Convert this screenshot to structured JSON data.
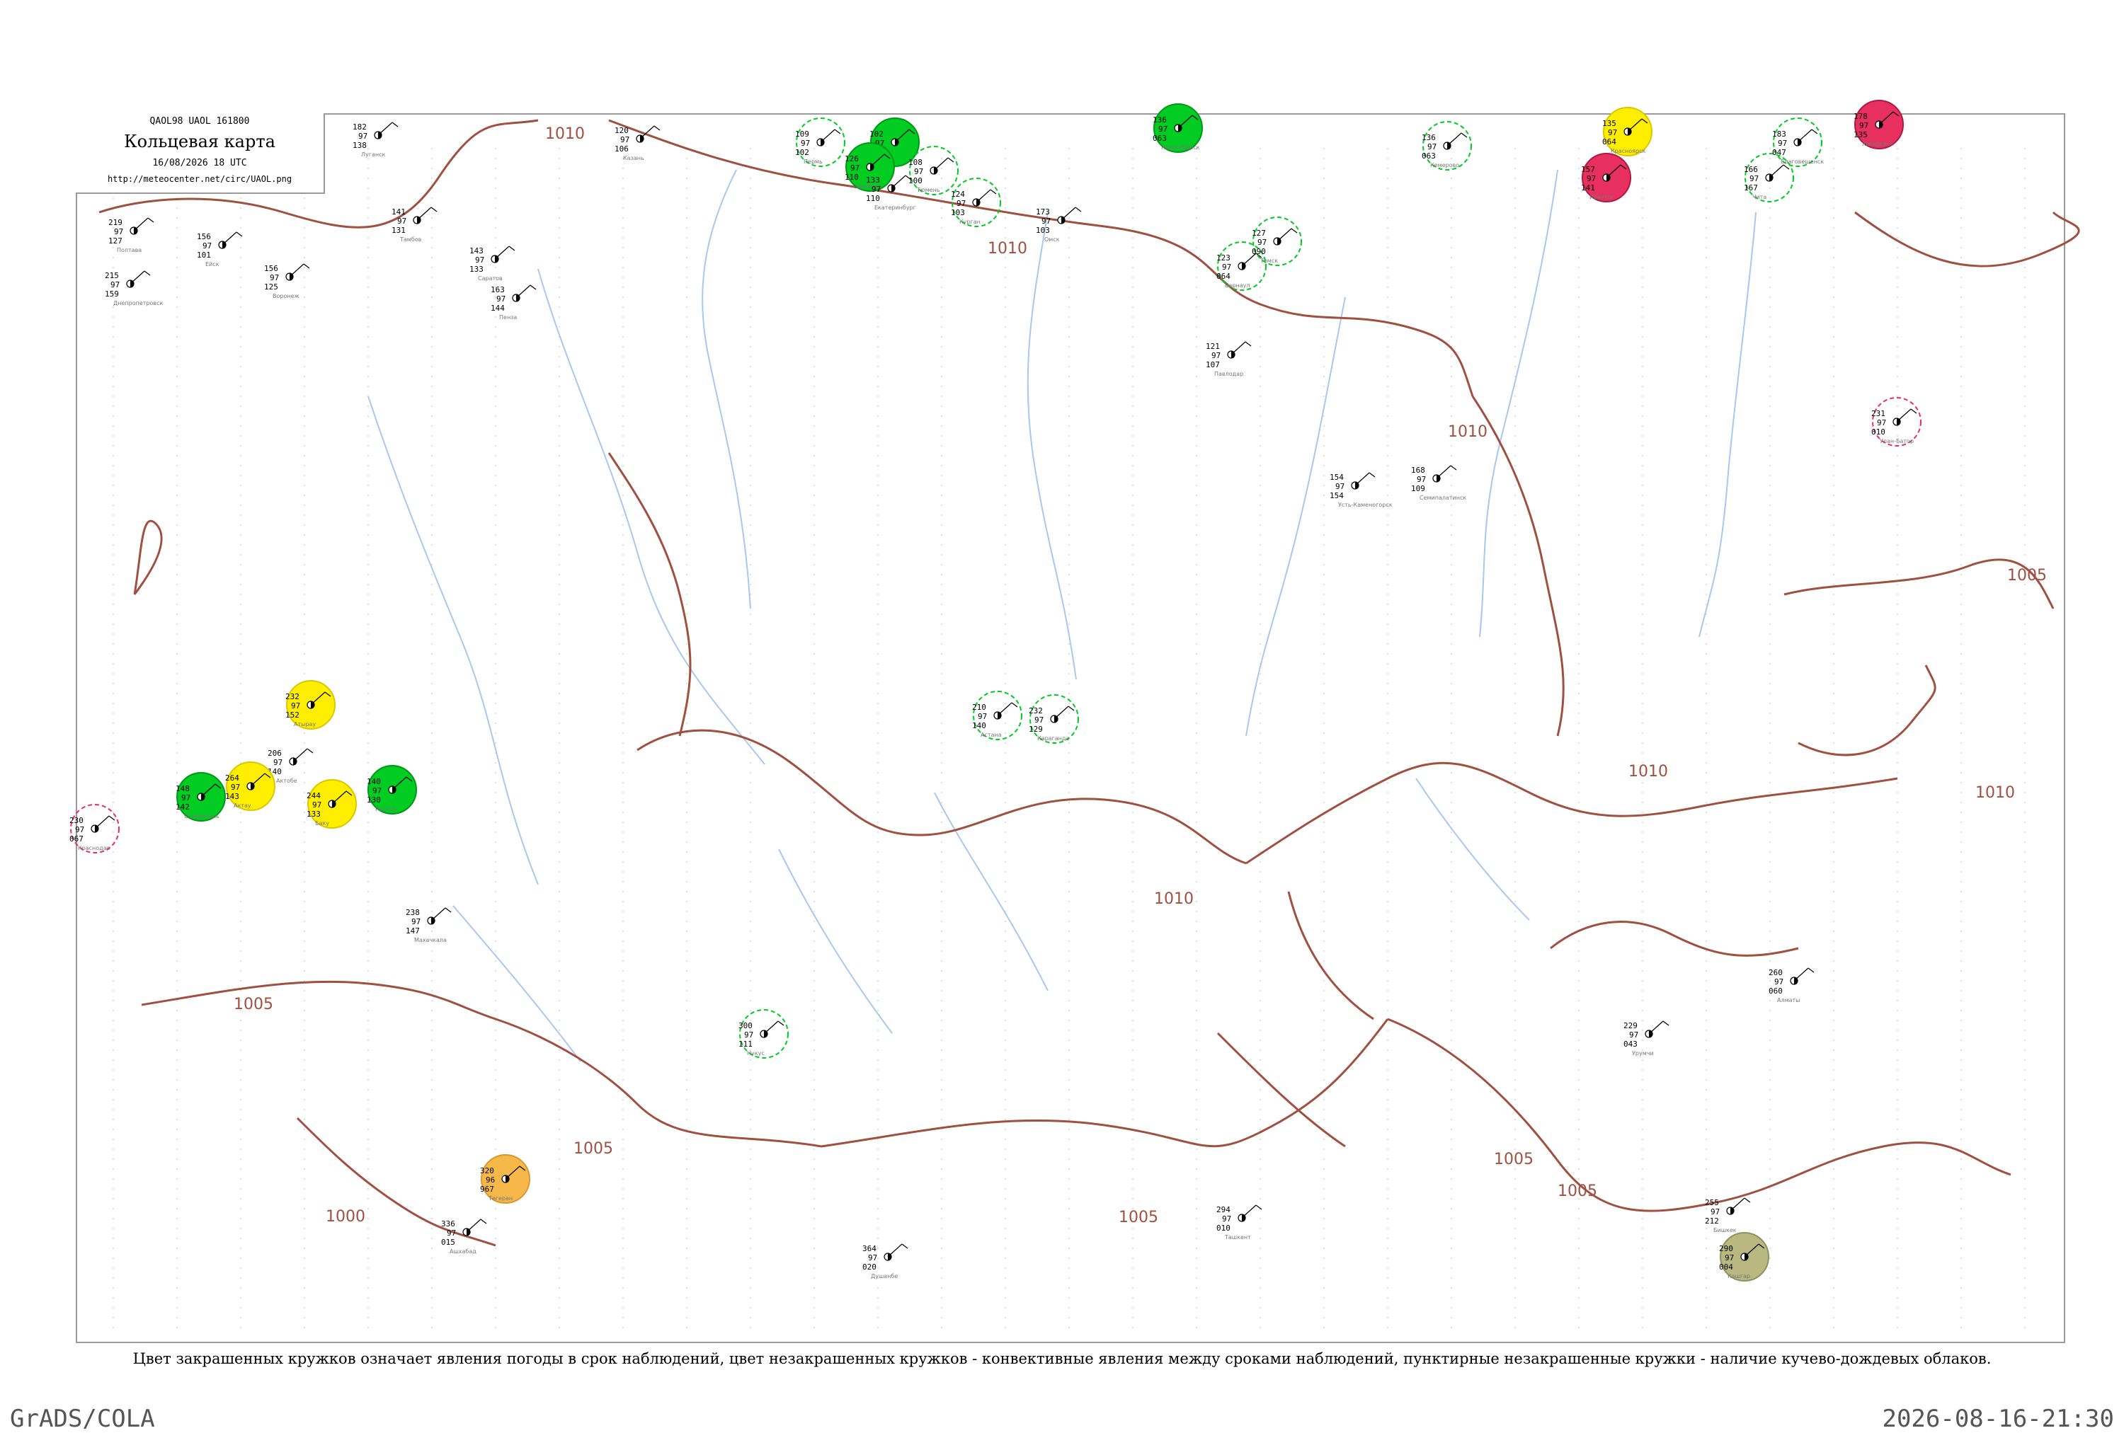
{
  "header": {
    "codes": "QAOL98  UAOL  161800",
    "title": "Кольцевая карта",
    "time": "16/08/2026 18 UTC",
    "url": "http://meteocenter.net/circ/UAOL.png"
  },
  "caption": "Цвет закрашенных кружков означает явления погоды в срок наблюдений, цвет незакрашенных кружков - конвективные явления между сроками наблюдений, пунктирные незакрашенные кружки - наличие кучево-дождевых облаков.",
  "footer": {
    "left": "GrADS/COLA",
    "right": "2026-08-16-21:30"
  },
  "colors": {
    "isobar": "#a05040",
    "river": "#a8c8f0",
    "thunderstorm": "#00cc22",
    "hail_or_heavy": "#e83060",
    "rain": "#ffee00",
    "dust": "#f7b84a",
    "fog": "#b8b880"
  },
  "map": {
    "isobar_labels": [
      "1010",
      "1010",
      "1010",
      "1010",
      "1010",
      "1010",
      "1005",
      "1005",
      "1005",
      "1005",
      "1005",
      "1005",
      "1000"
    ],
    "stations": [
      {
        "name": "Луганск",
        "pressure": "182",
        "temp": "97",
        "dew": "138",
        "marker": "none"
      },
      {
        "name": "Полтава",
        "pressure": "219",
        "temp": "97",
        "dew": "127",
        "marker": "none"
      },
      {
        "name": "Днепропетровск",
        "pressure": "215",
        "temp": "97",
        "dew": "159",
        "marker": "none"
      },
      {
        "name": "Ейск",
        "pressure": "156",
        "temp": "97",
        "dew": "101",
        "marker": "none"
      },
      {
        "name": "Воронеж",
        "pressure": "156",
        "temp": "97",
        "dew": "125",
        "marker": "none"
      },
      {
        "name": "Тамбов",
        "pressure": "141",
        "temp": "97",
        "dew": "131",
        "marker": "none"
      },
      {
        "name": "Саратов",
        "pressure": "143",
        "temp": "97",
        "dew": "133",
        "marker": "none"
      },
      {
        "name": "Пенза",
        "pressure": "163",
        "temp": "97",
        "dew": "144",
        "marker": "none"
      },
      {
        "name": "Казань",
        "pressure": "120",
        "temp": "97",
        "dew": "106",
        "marker": "none"
      },
      {
        "name": "Уфа",
        "pressure": "102",
        "temp": "97",
        "dew": "94",
        "marker": "thunder-filled"
      },
      {
        "name": "Оренбург",
        "pressure": "126",
        "temp": "97",
        "dew": "110",
        "marker": "thunder-filled"
      },
      {
        "name": "Пермь",
        "pressure": "109",
        "temp": "97",
        "dew": "102",
        "marker": "thunder-dashed"
      },
      {
        "name": "Екатеринбург",
        "pressure": "133",
        "temp": "97",
        "dew": "110",
        "marker": "none"
      },
      {
        "name": "Тюмень",
        "pressure": "108",
        "temp": "97",
        "dew": "100",
        "marker": "thunder-dashed"
      },
      {
        "name": "Курган",
        "pressure": "124",
        "temp": "97",
        "dew": "103",
        "marker": "thunder-dashed"
      },
      {
        "name": "Омск",
        "pressure": "173",
        "temp": "97",
        "dew": "103",
        "marker": "none"
      },
      {
        "name": "Новосибирск",
        "pressure": "136",
        "temp": "97",
        "dew": "063",
        "marker": "thunder-filled"
      },
      {
        "name": "Барнаул",
        "pressure": "123",
        "temp": "97",
        "dew": "064",
        "marker": "thunder-dashed"
      },
      {
        "name": "Томск",
        "pressure": "127",
        "temp": "97",
        "dew": "090",
        "marker": "thunder-dashed"
      },
      {
        "name": "Кемерово",
        "pressure": "136",
        "temp": "97",
        "dew": "063",
        "marker": "thunder-dashed"
      },
      {
        "name": "Красноярск",
        "pressure": "135",
        "temp": "97",
        "dew": "064",
        "marker": "rain-filled"
      },
      {
        "name": "Иркутск",
        "pressure": "157",
        "temp": "97",
        "dew": "141",
        "marker": "hail-filled"
      },
      {
        "name": "Чита",
        "pressure": "166",
        "temp": "97",
        "dew": "167",
        "marker": "thunder-dashed"
      },
      {
        "name": "Благовещенск",
        "pressure": "183",
        "temp": "97",
        "dew": "047",
        "marker": "thunder-dashed"
      },
      {
        "name": "Хабаровск",
        "pressure": "178",
        "temp": "97",
        "dew": "135",
        "marker": "hail-filled"
      },
      {
        "name": "Актобе",
        "pressure": "206",
        "temp": "97",
        "dew": "140",
        "marker": "none"
      },
      {
        "name": "Атырау",
        "pressure": "232",
        "temp": "97",
        "dew": "152",
        "marker": "rain-filled"
      },
      {
        "name": "Астана",
        "pressure": "210",
        "temp": "97",
        "dew": "140",
        "marker": "thunder-dashed"
      },
      {
        "name": "Караганда",
        "pressure": "232",
        "temp": "97",
        "dew": "129",
        "marker": "thunder-dashed"
      },
      {
        "name": "Павлодар",
        "pressure": "121",
        "temp": "97",
        "dew": "107",
        "marker": "none"
      },
      {
        "name": "Семипалатинск",
        "pressure": "168",
        "temp": "97",
        "dew": "109",
        "marker": "none"
      },
      {
        "name": "Усть-Каменогорск",
        "pressure": "154",
        "temp": "97",
        "dew": "154",
        "marker": "none"
      },
      {
        "name": "Актау",
        "pressure": "264",
        "temp": "97",
        "dew": "143",
        "marker": "rain-filled"
      },
      {
        "name": "Нукус",
        "pressure": "300",
        "temp": "97",
        "dew": "111",
        "marker": "thunder-dashed"
      },
      {
        "name": "Ташкент",
        "pressure": "294",
        "temp": "97",
        "dew": "010",
        "marker": "none"
      },
      {
        "name": "Бишкек",
        "pressure": "255",
        "temp": "97",
        "dew": "212",
        "marker": "none"
      },
      {
        "name": "Алматы",
        "pressure": "260",
        "temp": "97",
        "dew": "060",
        "marker": "none"
      },
      {
        "name": "Урумчи",
        "pressure": "229",
        "temp": "97",
        "dew": "043",
        "marker": "none"
      },
      {
        "name": "Баку",
        "pressure": "244",
        "temp": "97",
        "dew": "133",
        "marker": "rain-filled"
      },
      {
        "name": "Тегеран",
        "pressure": "320",
        "temp": "96",
        "dew": "967",
        "marker": "dust-filled"
      },
      {
        "name": "Ашхабад",
        "pressure": "336",
        "temp": "97",
        "dew": "015",
        "marker": "none"
      },
      {
        "name": "Душанбе",
        "pressure": "364",
        "temp": "97",
        "dew": "020",
        "marker": "none"
      },
      {
        "name": "Кашгар",
        "pressure": "290",
        "temp": "97",
        "dew": "004",
        "marker": "fog-filled"
      },
      {
        "name": "Улан-Батор",
        "pressure": "231",
        "temp": "97",
        "dew": "010",
        "marker": "hail-dashed"
      },
      {
        "name": "Махачкала",
        "pressure": "238",
        "temp": "97",
        "dew": "147",
        "marker": "none"
      },
      {
        "name": "Ростов",
        "pressure": "140",
        "temp": "97",
        "dew": "130",
        "marker": "thunder-filled"
      },
      {
        "name": "Краснодар",
        "pressure": "230",
        "temp": "97",
        "dew": "067",
        "marker": "hail-dashed"
      },
      {
        "name": "Ставрополь",
        "pressure": "148",
        "temp": "97",
        "dew": "142",
        "marker": "thunder-filled"
      }
    ]
  }
}
